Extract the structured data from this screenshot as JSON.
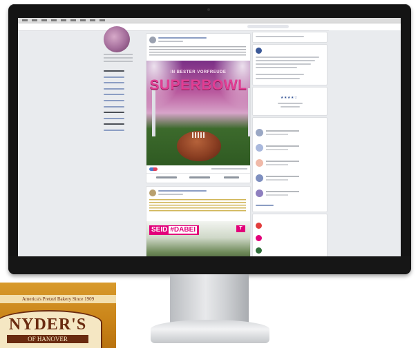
{
  "leftnav": {
    "items": []
  },
  "superbowl_post": {
    "image_small": "IN BESTER VORFREUDE",
    "image_big": "SUPERBOWL"
  },
  "dabei_post": {
    "image_text_left": "SEID",
    "image_text_hash": "#DABEI",
    "image_logo": "T"
  },
  "right_column": {
    "rating_stars": "★★★★☆",
    "page_like_items": []
  },
  "snack_bag": {
    "strip_text": "America's Pretzel Bakery Since 1909",
    "logo": "NYDER'S",
    "sub": "OF HANOVER"
  },
  "colors": {
    "fb_background": "#e9ebee",
    "fb_link": "#365899",
    "magenta": "#e2007a",
    "bezel": "#141414"
  }
}
